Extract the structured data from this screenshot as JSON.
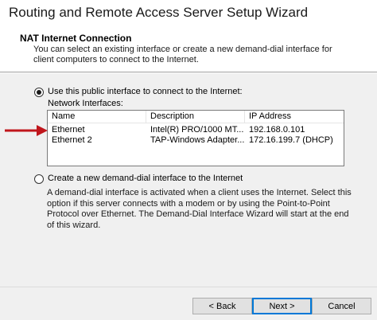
{
  "window": {
    "title": "Routing and Remote Access Server Setup Wizard"
  },
  "header": {
    "title": "NAT Internet Connection",
    "description": "You can select an existing interface or create a new demand-dial interface for client computers to connect to the Internet."
  },
  "options": {
    "public_interface": {
      "label": "Use this public interface to connect to the Internet:",
      "selected": true
    },
    "network_interfaces_label": "Network Interfaces:",
    "demand_dial": {
      "label": "Create a new demand-dial interface to the Internet",
      "selected": false,
      "description": "A demand-dial interface is activated when a client uses the Internet. Select this option if this server connects with a modem or by using the Point-to-Point Protocol over Ethernet. The Demand-Dial Interface Wizard will start at the end of this wizard."
    }
  },
  "interfaces": {
    "columns": [
      "Name",
      "Description",
      "IP Address"
    ],
    "rows": [
      {
        "name": "Ethernet",
        "description": "Intel(R) PRO/1000 MT...",
        "ip": "192.168.0.101"
      },
      {
        "name": "Ethernet 2",
        "description": "TAP-Windows Adapter...",
        "ip": "172.16.199.7 (DHCP)"
      }
    ]
  },
  "buttons": {
    "back": "< Back",
    "next": "Next >",
    "cancel": "Cancel"
  },
  "colors": {
    "arrow": "#c0161c",
    "focus": "#0078d7"
  },
  "icons": {
    "annotation": "red-arrow-icon"
  }
}
